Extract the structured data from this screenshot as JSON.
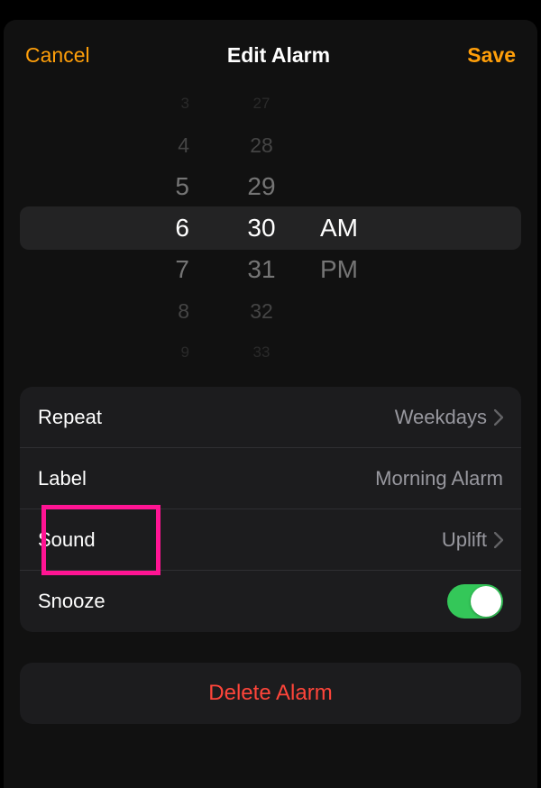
{
  "header": {
    "cancel": "Cancel",
    "title": "Edit Alarm",
    "save": "Save"
  },
  "picker": {
    "hours": [
      "3",
      "4",
      "5",
      "6",
      "7",
      "8",
      "9"
    ],
    "minutes": [
      "27",
      "28",
      "29",
      "30",
      "31",
      "32",
      "33"
    ],
    "ampm": [
      "AM",
      "PM"
    ]
  },
  "rows": {
    "repeat": {
      "label": "Repeat",
      "value": "Weekdays"
    },
    "label_row": {
      "label": "Label",
      "value": "Morning Alarm"
    },
    "sound": {
      "label": "Sound",
      "value": "Uplift"
    },
    "snooze": {
      "label": "Snooze",
      "on": true
    }
  },
  "delete": "Delete Alarm",
  "colors": {
    "accent": "#ff9f0a",
    "destructive": "#ff453a",
    "toggle_on": "#34c759",
    "highlight": "#ff1493"
  }
}
